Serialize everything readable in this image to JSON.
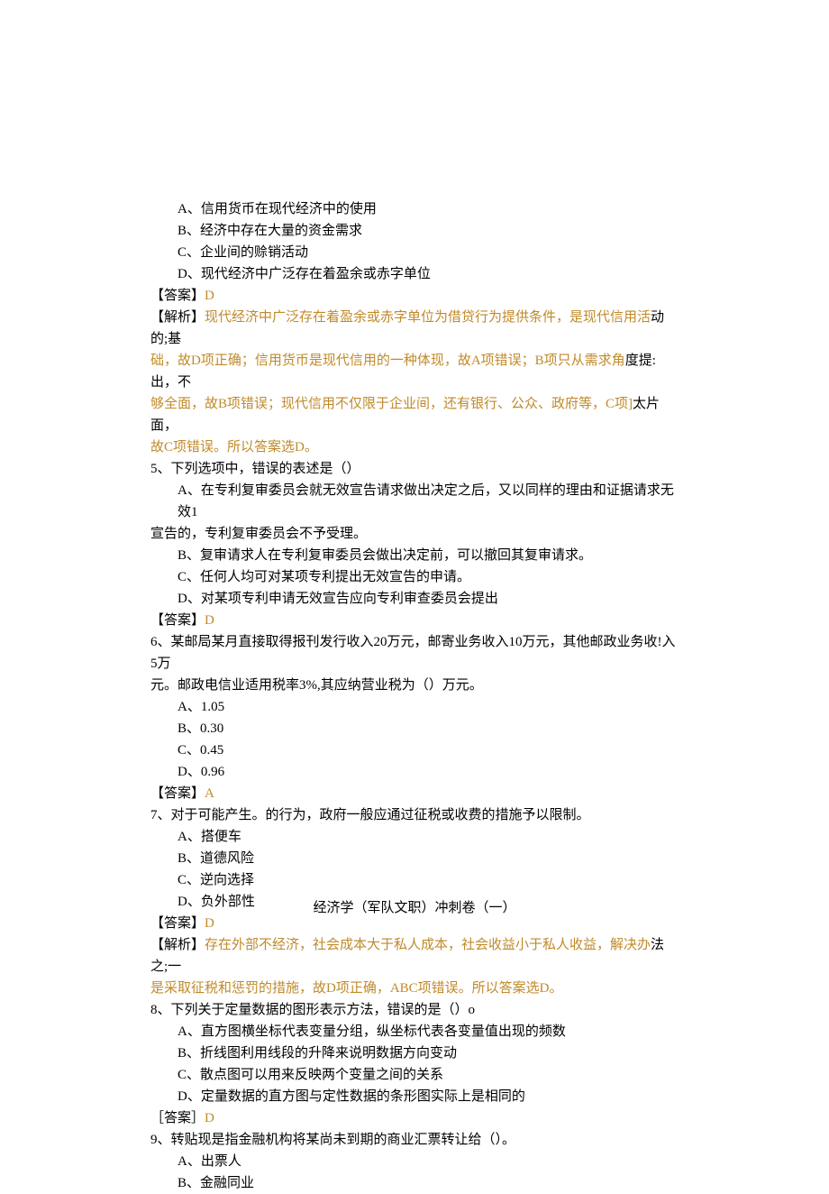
{
  "q4": {
    "A": "A、信用货币在现代经济中的使用",
    "B": "B、经济中存在大量的资金需求",
    "C": "C、企业间的赊销活动",
    "D": "D、现代经济中广泛存在着盈余或赤字单位",
    "ans_label": "【答案】",
    "ans_letter": "D",
    "ana_label": "【解析】",
    "ana_part1": "现代经济中广泛存在着盈余或赤字单位为借贷行为提供条件，是现代信用活",
    "ana_tail1a": "动的;基",
    "ana_part2": "础，故D项正确；信用货币是现代信用的一种体现，故A项错误；B项只从需求角",
    "ana_tail2": "度提:出，不",
    "ana_part3": "够全面，故B项错误；现代信用不仅限于企业间，还有银行、公众、政府等，C项]",
    "ana_tail3": "太片面，",
    "ana_part4": "故C项错误。所以答案选D。"
  },
  "q5": {
    "stem": "5、下列选项中，错误的表述是（）",
    "A1": "A、在专利复审委员会就无效宣告请求做出决定之后，又以同样的理由和证据请求无效1",
    "A2": "宣告的，专利复审委员会不予受理。",
    "B": "B、复审请求人在专利复审委员会做出决定前，可以撤回其复审请求。",
    "C": "C、任何人均可对某项专利提出无效宣告的申请。",
    "D": "D、对某项专利申请无效宣告应向专利审查委员会提出",
    "ans_label": "【答案】",
    "ans_letter": "D"
  },
  "q6": {
    "stem1": "6、某邮局某月直接取得报刊发行收入20万元，邮寄业务收入10万元，其他邮政业务收!入5万",
    "stem2": "元。邮政电信业适用税率3%,其应纳营业税为（）万元。",
    "A": "A、1.05",
    "B": "B、0.30",
    "C": "C、0.45",
    "D": "D、0.96",
    "ans_label": "【答案】",
    "ans_letter": "A"
  },
  "q7": {
    "stem": "7、对于可能产生。的行为，政府一般应通过征税或收费的措施予以限制。",
    "A": "A、搭便车",
    "B": "B、道德风险",
    "C": "C、逆向选择",
    "D": "D、负外部性",
    "ans_label": "【答案】",
    "ans_letter": "D",
    "ana_label": "【解析】",
    "ana_part1": "存在外部不经济，社会成本大于私人成本，社会收益小于私人收益，解决办",
    "ana_tail1": "法之;一",
    "ana_part2": "是采取征税和惩罚的措施，故D项正确，ABC项错误。所以答案选D。"
  },
  "q8": {
    "stem": "8、下列关于定量数据的图形表示方法，错误的是（）o",
    "A": "A、直方图横坐标代表变量分组，纵坐标代表各变量值出现的频数",
    "B": "B、折线图利用线段的升降来说明数据方向变动",
    "C": "C、散点图可以用来反映两个变量之间的关系",
    "D": "D、定量数据的直方图与定性数据的条形图实际上是相同的",
    "ans_label": "［答案］",
    "ans_letter": "D"
  },
  "q9": {
    "stem": "9、转贴现是指金融机构将某尚未到期的商业汇票转让给（）。",
    "A": "A、出票人",
    "B": "B、金融同业"
  },
  "footer": "经济学（军队文职）冲刺卷（一）"
}
